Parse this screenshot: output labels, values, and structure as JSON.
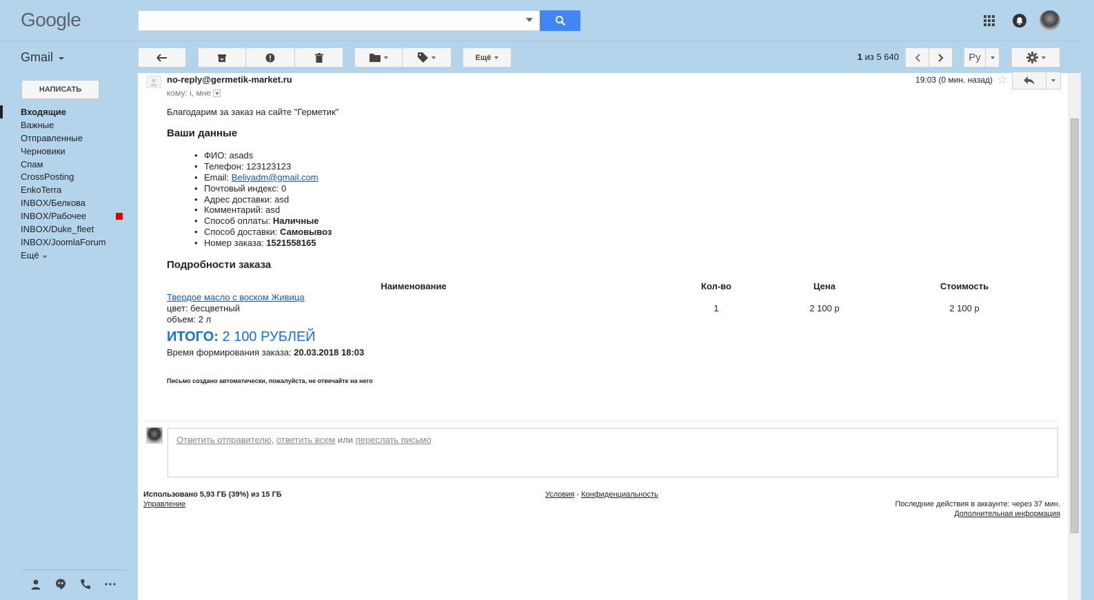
{
  "header": {
    "logo": "Google",
    "search": {
      "value": "",
      "placeholder": ""
    }
  },
  "toolbar": {
    "app_name": "Gmail",
    "more_label": "Ещё",
    "count_current": "1",
    "count_text": " из 5 640",
    "lang_label": "Ру"
  },
  "sidebar": {
    "compose_label": "НАПИСАТЬ",
    "items": [
      {
        "label": "Входящие"
      },
      {
        "label": "Важные"
      },
      {
        "label": "Отправленные"
      },
      {
        "label": "Черновики"
      },
      {
        "label": "Спам"
      },
      {
        "label": "CrossPosting"
      },
      {
        "label": "EnkoTerra"
      },
      {
        "label": "INBOX/Белкова"
      },
      {
        "label": "INBOX/Рабочее",
        "color": "#dd0000"
      },
      {
        "label": "INBOX/Duke_fleet"
      },
      {
        "label": "INBOX/JoomlaForum"
      },
      {
        "label": "Ещё"
      }
    ]
  },
  "message": {
    "sender": "no-reply@germetik-market.ru",
    "to": "кому: i, мне",
    "time": "19:03 (0 мин. назад)",
    "greeting": "Благодарим за заказ на сайте \"Герметик\"",
    "your_data_heading": "Ваши данные",
    "data": {
      "fio_label": "ФИО: ",
      "fio": "asads",
      "phone_label": "Телефон: ",
      "phone": "123123123",
      "email_label": "Email: ",
      "email": "Beliyadm@gmail.com",
      "zip_label": "Почтовый индекс: ",
      "zip": "0",
      "address_label": "Адрес доставки: ",
      "address": "asd",
      "comment_label": "Комментарий: ",
      "comment": "asd",
      "payment_label": "Способ оплаты: ",
      "payment": "Наличные",
      "delivery_label": "Способ доставки: ",
      "delivery": "Самовывоз",
      "order_label": "Номер заказа: ",
      "order": "1521558165"
    },
    "details_heading": "Подробности заказа",
    "table": {
      "headers": [
        "Наименование",
        "Кол-во",
        "Цена",
        "Стоимость"
      ],
      "row": {
        "name": "Твердое масло с воском Живица",
        "color": "цвет: бесцветный",
        "volume": "объем: 2 л",
        "qty": "1",
        "price": "2 100 р",
        "cost": "2 100 р"
      }
    },
    "total_label": "ИТОГО:",
    "total_value": " 2 100 РУБЛЕЙ",
    "formed_label": "Время формирования заказа: ",
    "formed_value": "20.03.2018 18:03",
    "auto_note": "Письмо создано автоматически, пожалуйста, не отвечайте на него"
  },
  "reply": {
    "reply_sender": "Ответить отправителю",
    "sep1": ", ",
    "reply_all": "ответить всем",
    "or": " или ",
    "forward": "переслать письмо"
  },
  "footer": {
    "usage": "Использовано 5,93 ГБ (39%) из 15 ГБ",
    "manage": "Управление",
    "terms": "Условия",
    "dash": " - ",
    "privacy": "Конфиденциальность",
    "last_activity": "Последние действия в аккаунте: через 37 мин.",
    "more_info": "Дополнительная информация"
  },
  "colors": {
    "accent": "#4285f4",
    "chrome": "#b4d4ec",
    "link": "#1155cc",
    "total": "#1a6fd9"
  }
}
